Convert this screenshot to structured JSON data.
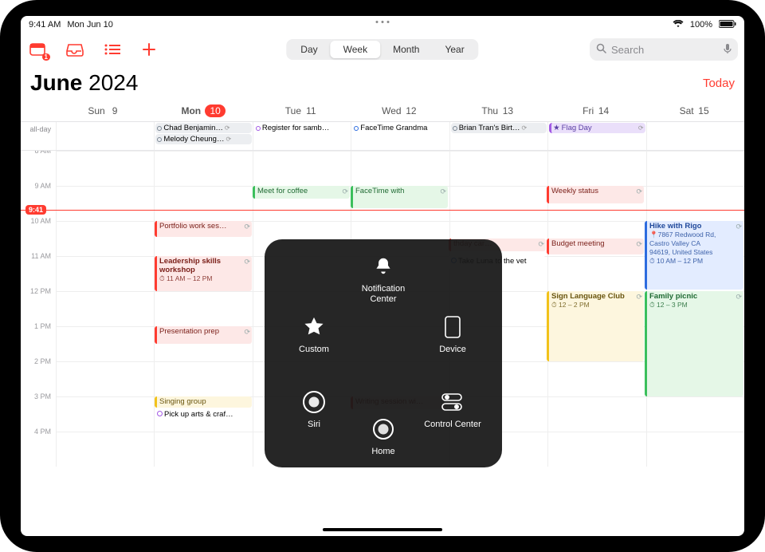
{
  "status": {
    "time": "9:41 AM",
    "date": "Mon Jun 10",
    "wifi": "wifi-icon",
    "battery_pct": "100%"
  },
  "toolbar": {
    "views": {
      "day": "Day",
      "week": "Week",
      "month": "Month",
      "year": "Year"
    },
    "search_placeholder": "Search"
  },
  "header": {
    "month": "June",
    "year": "2024",
    "today": "Today"
  },
  "days": [
    {
      "label": "Sun",
      "num": "9"
    },
    {
      "label": "Mon",
      "num": "10",
      "today": true
    },
    {
      "label": "Tue",
      "num": "11"
    },
    {
      "label": "Wed",
      "num": "12"
    },
    {
      "label": "Thu",
      "num": "13"
    },
    {
      "label": "Fri",
      "num": "14"
    },
    {
      "label": "Sat",
      "num": "15"
    }
  ],
  "allday_label": "all-day",
  "allday": {
    "mon": [
      "Chad Benjamin…",
      "Melody Cheung…"
    ],
    "tue": [
      "Register for samb…"
    ],
    "wed": [
      "FaceTime Grandma"
    ],
    "thu": [
      "Brian Tran's Birt…"
    ],
    "fri": [
      "Flag Day"
    ]
  },
  "hours": [
    "8 AM",
    "9 AM",
    "10 AM",
    "11 AM",
    "12 PM",
    "1 PM",
    "2 PM",
    "3 PM",
    "4 PM"
  ],
  "now_label": "9:41",
  "events": {
    "mon": {
      "portfolio": "Portfolio work ses…",
      "leadership": "Leadership skills workshop",
      "leadership_time": "11 AM – 12 PM",
      "presentation": "Presentation prep",
      "singing": "Singing group",
      "pickup": "Pick up arts & craf…"
    },
    "tue": {
      "coffee": "Meet for coffee"
    },
    "wed": {
      "facetime": "FaceTime with",
      "writing": "Writing session wi…"
    },
    "thu": {
      "bday": "thday car…",
      "luna": "Take Luna to the vet"
    },
    "fri": {
      "weekly": "Weekly status",
      "budget": "Budget meeting",
      "signlang": "Sign Language Club",
      "signlang_time": "12 – 2 PM"
    },
    "sat": {
      "hike": "Hike with Rigo",
      "hike_addr1": "7867 Redwood Rd,",
      "hike_addr2": "Castro Valley CA",
      "hike_addr3": "94619, United States",
      "hike_time": "10 AM – 12 PM",
      "picnic": "Family picnic",
      "picnic_time": "12 – 3 PM"
    }
  },
  "atouch": {
    "notification": "Notification Center",
    "custom": "Custom",
    "device": "Device",
    "siri": "Siri",
    "home": "Home",
    "control": "Control Center"
  }
}
